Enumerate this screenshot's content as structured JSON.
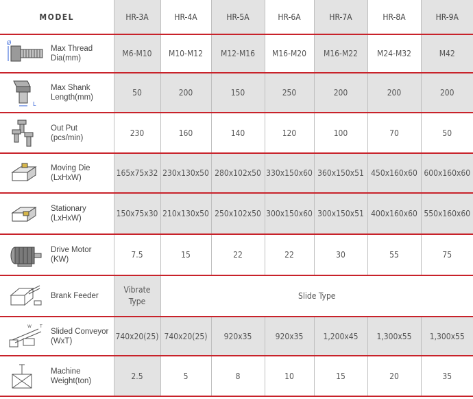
{
  "table": {
    "header": "MODEL",
    "models": [
      "HR-3A",
      "HR-4A",
      "HR-5A",
      "HR-6A",
      "HR-7A",
      "HR-8A",
      "HR-9A"
    ],
    "rows": [
      {
        "label": "Max Thread\nDia(mm)",
        "icon": "bolt-thread-icon",
        "values": [
          "M6-M10",
          "M10-M12",
          "M12-M16",
          "M16-M20",
          "M16-M22",
          "M24-M32",
          "M42"
        ]
      },
      {
        "label": "Max Shank\nLength(mm)",
        "icon": "bolt-shank-icon",
        "values": [
          "50",
          "200",
          "150",
          "250",
          "200",
          "200",
          "200"
        ]
      },
      {
        "label": "Out Put\n(pcs/min)",
        "icon": "bolts-output-icon",
        "values": [
          "230",
          "160",
          "140",
          "120",
          "100",
          "70",
          "50"
        ]
      },
      {
        "label": "Moving Die\n(LxHxW)",
        "icon": "moving-die-icon",
        "values": [
          "165x75x32",
          "230x130x50",
          "280x102x50",
          "330x150x60",
          "360x150x51",
          "450x160x60",
          "600x160x60"
        ]
      },
      {
        "label": "Stationary\n(LxHxW)",
        "icon": "stationary-die-icon",
        "values": [
          "150x75x30",
          "210x130x50",
          "250x102x50",
          "300x150x60",
          "300x150x51",
          "400x160x60",
          "550x160x60"
        ]
      },
      {
        "label": "Drive Motor\n(KW)",
        "icon": "motor-icon",
        "values": [
          "7.5",
          "15",
          "22",
          "22",
          "30",
          "55",
          "75"
        ]
      },
      {
        "label": "Brank Feeder",
        "icon": "feeder-icon",
        "first": "Vibrate\nType",
        "merged": "Slide Type"
      },
      {
        "label": "Slided Conveyor\n(WxT)",
        "icon": "conveyor-icon",
        "values": [
          "740x20(25)",
          "740x20(25)",
          "920x35",
          "920x35",
          "1,200x45",
          "1,300x55",
          "1,300x55"
        ]
      },
      {
        "label": "Machine\nWeight(ton)",
        "icon": "weight-box-icon",
        "values": [
          "2.5",
          "5",
          "8",
          "10",
          "15",
          "20",
          "35"
        ]
      }
    ]
  },
  "colors": {
    "accent": "#c8222a",
    "shade": "#e3e3e3",
    "grid": "#bfbfbf"
  }
}
